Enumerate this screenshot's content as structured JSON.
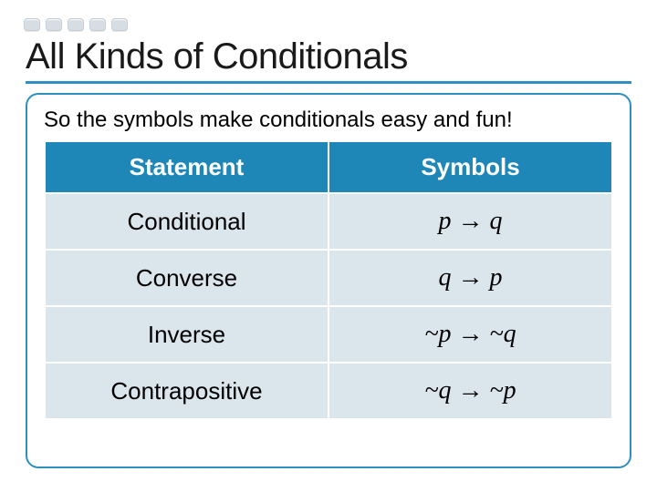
{
  "title": "All Kinds of Conditionals",
  "intro": "So the symbols make conditionals easy and fun!",
  "headers": {
    "statement": "Statement",
    "symbols": "Symbols"
  },
  "rows": [
    {
      "statement": "Conditional",
      "symbol": "p → q"
    },
    {
      "statement": "Converse",
      "symbol": "q → p"
    },
    {
      "statement": "Inverse",
      "symbol": "~p → ~q"
    },
    {
      "statement": "Contrapositive",
      "symbol": "~q → ~p"
    }
  ]
}
